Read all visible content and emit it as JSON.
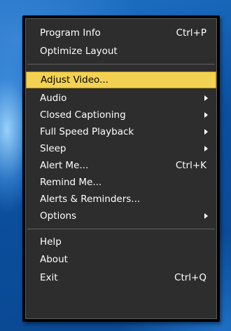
{
  "menu": {
    "items": [
      {
        "label": "Program Info",
        "shortcut": "Ctrl+P"
      },
      {
        "label": "Optimize Layout",
        "shortcut": ""
      },
      {
        "label": "Adjust Video...",
        "shortcut": "",
        "highlighted": true
      },
      {
        "label": "Audio",
        "shortcut": "",
        "submenu": true
      },
      {
        "label": "Closed Captioning",
        "shortcut": "",
        "submenu": true
      },
      {
        "label": "Full Speed Playback",
        "shortcut": "",
        "submenu": true
      },
      {
        "label": "Sleep",
        "shortcut": "",
        "submenu": true
      },
      {
        "label": "Alert Me...",
        "shortcut": "Ctrl+K"
      },
      {
        "label": "Remind Me...",
        "shortcut": ""
      },
      {
        "label": "Alerts & Reminders...",
        "shortcut": ""
      },
      {
        "label": "Options",
        "shortcut": "",
        "submenu": true
      },
      {
        "label": "Help",
        "shortcut": ""
      },
      {
        "label": "About",
        "shortcut": ""
      },
      {
        "label": "Exit",
        "shortcut": "Ctrl+Q"
      }
    ]
  },
  "colors": {
    "menu_background": "#2d2d2d",
    "highlight": "#f3d253",
    "text": "#ffffff",
    "highlight_text": "#000000",
    "desktop": "#0f5aa8"
  }
}
